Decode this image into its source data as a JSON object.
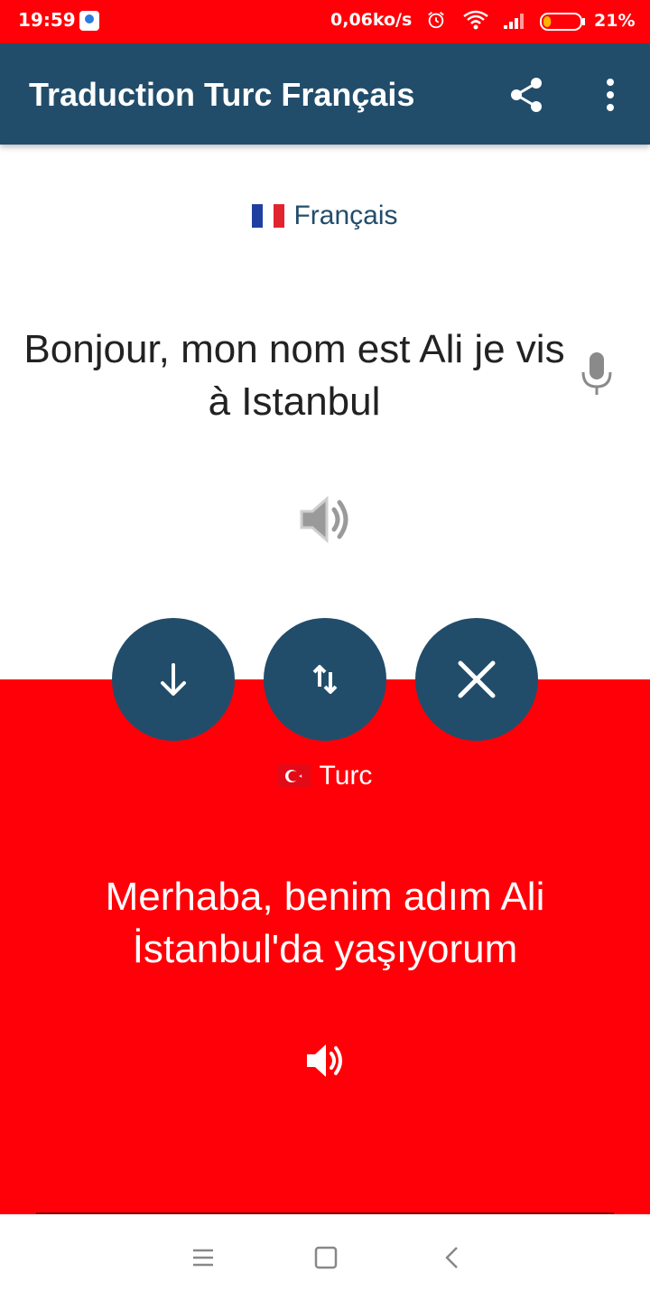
{
  "status_bar": {
    "time": "19:59",
    "network_speed": "0,06ko/s",
    "battery_percent": "21%",
    "battery_level": 0.21,
    "icons": [
      "app-notification-icon",
      "alarm-icon",
      "wifi-icon",
      "signal-icon",
      "battery-icon"
    ]
  },
  "app_bar": {
    "title": "Traduction Turc Français",
    "actions": [
      "share-icon",
      "more-vert-icon"
    ]
  },
  "source": {
    "language": "Français",
    "flag": "france",
    "text": "Bonjour, mon nom est Ali je vis à Istanbul"
  },
  "buttons": {
    "translate": "arrow-down-icon",
    "swap": "swap-vertical-icon",
    "clear": "close-icon"
  },
  "target": {
    "language": "Turc",
    "flag": "turkey",
    "text": "Merhaba, benim adım Ali İstanbul'da yaşıyorum"
  },
  "nav_bar": {
    "icons": [
      "menu-icon",
      "home-icon",
      "back-icon"
    ]
  },
  "colors": {
    "primary": "#214d6b",
    "accent_red": "#ff0008",
    "text_dark": "#222222",
    "icon_gray": "#8a8a8a"
  }
}
